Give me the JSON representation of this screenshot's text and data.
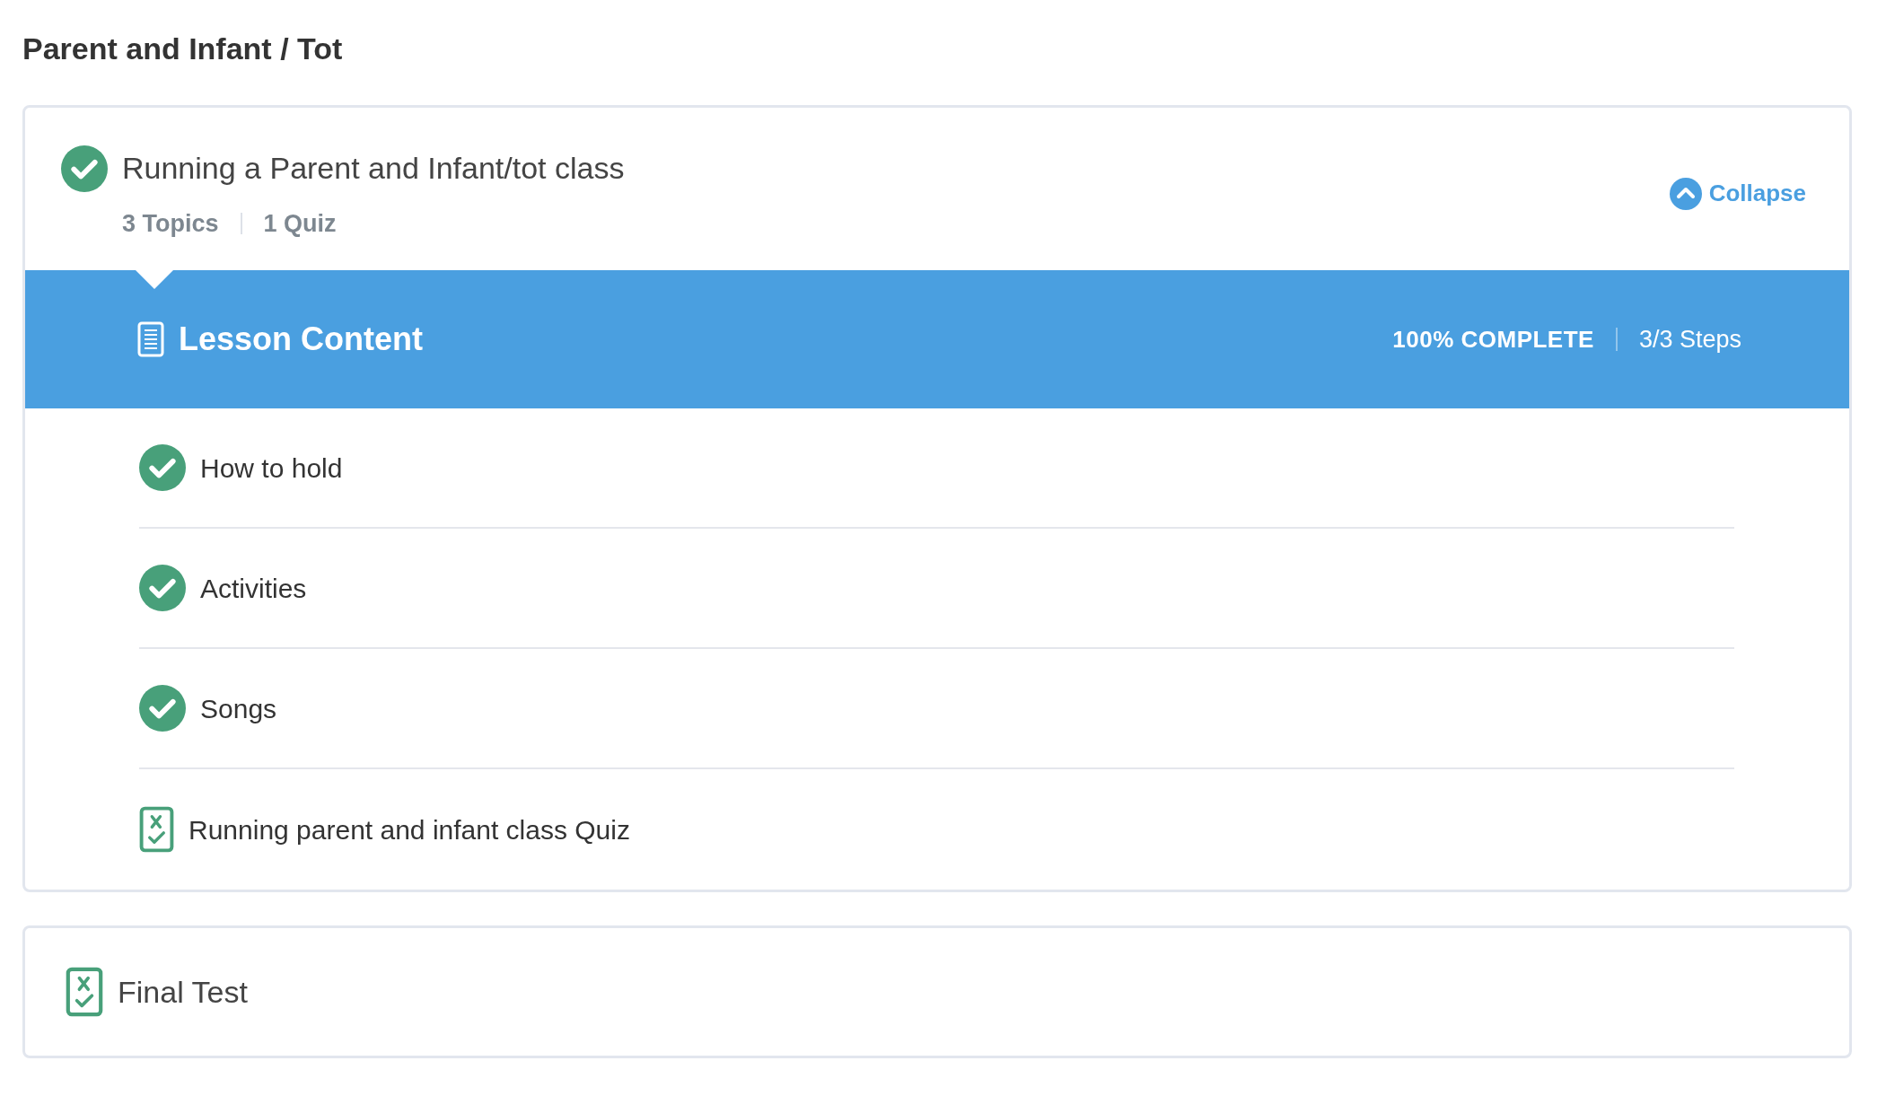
{
  "section_title": "Parent and Infant / Tot",
  "lesson": {
    "title": "Running a Parent and Infant/tot class",
    "completed": true,
    "meta": [
      "3 Topics",
      "1 Quiz"
    ],
    "toggle": "Collapse",
    "expanded": true,
    "content": {
      "heading": "Lesson Content",
      "progress": "100% COMPLETE",
      "steps": "3/3 Steps",
      "items": [
        {
          "kind": "topic",
          "label": "How to hold",
          "completed": true
        },
        {
          "kind": "topic",
          "label": "Activities",
          "completed": true
        },
        {
          "kind": "topic",
          "label": "Songs",
          "completed": true
        },
        {
          "kind": "quiz",
          "label": "Running parent and infant class Quiz"
        }
      ]
    }
  },
  "final": {
    "kind": "quiz",
    "label": "Final Test"
  }
}
